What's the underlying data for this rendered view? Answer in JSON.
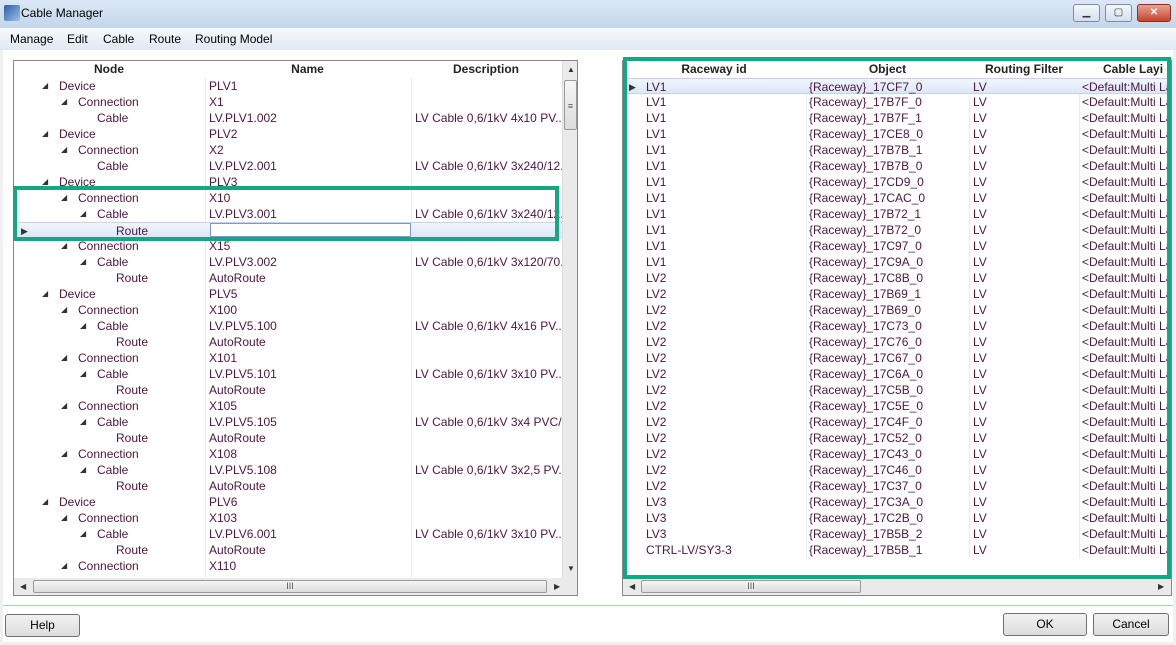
{
  "window": {
    "title": "Cable Manager",
    "minimize": "▁",
    "maximize": "▢",
    "close": "✕"
  },
  "menu": [
    "Manage",
    "Edit",
    "Cable",
    "Route",
    "Routing Model"
  ],
  "tree": {
    "columns": [
      "Node",
      "Name",
      "Description"
    ],
    "rows": [
      {
        "node": "Device",
        "level": 0,
        "expander": true,
        "name": "PLV1",
        "desc": ""
      },
      {
        "node": "Connection",
        "level": 1,
        "expander": true,
        "name": "X1",
        "desc": ""
      },
      {
        "node": "Cable",
        "level": 2,
        "expander": false,
        "name": "LV.PLV1.002",
        "desc": "LV Cable 0,6/1kV 4x10 PV..."
      },
      {
        "node": "Device",
        "level": 0,
        "expander": true,
        "name": "PLV2",
        "desc": ""
      },
      {
        "node": "Connection",
        "level": 1,
        "expander": true,
        "name": "X2",
        "desc": ""
      },
      {
        "node": "Cable",
        "level": 2,
        "expander": false,
        "name": "LV.PLV2.001",
        "desc": "LV Cable 0,6/1kV 3x240/12..."
      },
      {
        "node": "Device",
        "level": 0,
        "expander": true,
        "name": "PLV3",
        "desc": ""
      },
      {
        "node": "Connection",
        "level": 1,
        "expander": true,
        "name": "X10",
        "desc": ""
      },
      {
        "node": "Cable",
        "level": 2,
        "expander": true,
        "name": "LV.PLV3.001",
        "desc": "LV Cable 0,6/1kV 3x240/12..."
      },
      {
        "node": "Route",
        "level": 3,
        "expander": false,
        "name": "",
        "desc": "",
        "selected": true
      },
      {
        "node": "Connection",
        "level": 1,
        "expander": true,
        "name": "X15",
        "desc": ""
      },
      {
        "node": "Cable",
        "level": 2,
        "expander": true,
        "name": "LV.PLV3.002",
        "desc": "LV Cable 0,6/1kV 3x120/70..."
      },
      {
        "node": "Route",
        "level": 3,
        "expander": false,
        "name": "AutoRoute",
        "desc": ""
      },
      {
        "node": "Device",
        "level": 0,
        "expander": true,
        "name": "PLV5",
        "desc": ""
      },
      {
        "node": "Connection",
        "level": 1,
        "expander": true,
        "name": "X100",
        "desc": ""
      },
      {
        "node": "Cable",
        "level": 2,
        "expander": true,
        "name": "LV.PLV5.100",
        "desc": "LV Cable 0,6/1kV 4x16 PV..."
      },
      {
        "node": "Route",
        "level": 3,
        "expander": false,
        "name": "AutoRoute",
        "desc": ""
      },
      {
        "node": "Connection",
        "level": 1,
        "expander": true,
        "name": "X101",
        "desc": ""
      },
      {
        "node": "Cable",
        "level": 2,
        "expander": true,
        "name": "LV.PLV5.101",
        "desc": "LV Cable 0,6/1kV 3x10 PV..."
      },
      {
        "node": "Route",
        "level": 3,
        "expander": false,
        "name": "AutoRoute",
        "desc": ""
      },
      {
        "node": "Connection",
        "level": 1,
        "expander": true,
        "name": "X105",
        "desc": ""
      },
      {
        "node": "Cable",
        "level": 2,
        "expander": true,
        "name": "LV.PLV5.105",
        "desc": "LV Cable 0,6/1kV 3x4 PVC/..."
      },
      {
        "node": "Route",
        "level": 3,
        "expander": false,
        "name": "AutoRoute",
        "desc": ""
      },
      {
        "node": "Connection",
        "level": 1,
        "expander": true,
        "name": "X108",
        "desc": ""
      },
      {
        "node": "Cable",
        "level": 2,
        "expander": true,
        "name": "LV.PLV5.108",
        "desc": "LV Cable 0,6/1kV 3x2,5 PV..."
      },
      {
        "node": "Route",
        "level": 3,
        "expander": false,
        "name": "AutoRoute",
        "desc": ""
      },
      {
        "node": "Device",
        "level": 0,
        "expander": true,
        "name": "PLV6",
        "desc": ""
      },
      {
        "node": "Connection",
        "level": 1,
        "expander": true,
        "name": "X103",
        "desc": ""
      },
      {
        "node": "Cable",
        "level": 2,
        "expander": true,
        "name": "LV.PLV6.001",
        "desc": "LV Cable 0,6/1kV 3x10 PV..."
      },
      {
        "node": "Route",
        "level": 3,
        "expander": false,
        "name": "AutoRoute",
        "desc": ""
      },
      {
        "node": "Connection",
        "level": 1,
        "expander": true,
        "name": "X110",
        "desc": ""
      }
    ]
  },
  "raceways": {
    "columns": [
      "Raceway id",
      "Object",
      "Routing Filter",
      "Cable Layi"
    ],
    "rows": [
      [
        "LV1",
        "{Raceway}_17CF7_0",
        "LV",
        "<Default:Multi La"
      ],
      [
        "LV1",
        "{Raceway}_17B7F_0",
        "LV",
        "<Default:Multi La"
      ],
      [
        "LV1",
        "{Raceway}_17B7F_1",
        "LV",
        "<Default:Multi La"
      ],
      [
        "LV1",
        "{Raceway}_17CE8_0",
        "LV",
        "<Default:Multi La"
      ],
      [
        "LV1",
        "{Raceway}_17B7B_1",
        "LV",
        "<Default:Multi La"
      ],
      [
        "LV1",
        "{Raceway}_17B7B_0",
        "LV",
        "<Default:Multi La"
      ],
      [
        "LV1",
        "{Raceway}_17CD9_0",
        "LV",
        "<Default:Multi La"
      ],
      [
        "LV1",
        "{Raceway}_17CAC_0",
        "LV",
        "<Default:Multi La"
      ],
      [
        "LV1",
        "{Raceway}_17B72_1",
        "LV",
        "<Default:Multi La"
      ],
      [
        "LV1",
        "{Raceway}_17B72_0",
        "LV",
        "<Default:Multi La"
      ],
      [
        "LV1",
        "{Raceway}_17C97_0",
        "LV",
        "<Default:Multi La"
      ],
      [
        "LV1",
        "{Raceway}_17C9A_0",
        "LV",
        "<Default:Multi La"
      ],
      [
        "LV2",
        "{Raceway}_17C8B_0",
        "LV",
        "<Default:Multi La"
      ],
      [
        "LV2",
        "{Raceway}_17B69_1",
        "LV",
        "<Default:Multi La"
      ],
      [
        "LV2",
        "{Raceway}_17B69_0",
        "LV",
        "<Default:Multi La"
      ],
      [
        "LV2",
        "{Raceway}_17C73_0",
        "LV",
        "<Default:Multi La"
      ],
      [
        "LV2",
        "{Raceway}_17C76_0",
        "LV",
        "<Default:Multi La"
      ],
      [
        "LV2",
        "{Raceway}_17C67_0",
        "LV",
        "<Default:Multi La"
      ],
      [
        "LV2",
        "{Raceway}_17C6A_0",
        "LV",
        "<Default:Multi La"
      ],
      [
        "LV2",
        "{Raceway}_17C5B_0",
        "LV",
        "<Default:Multi La"
      ],
      [
        "LV2",
        "{Raceway}_17C5E_0",
        "LV",
        "<Default:Multi La"
      ],
      [
        "LV2",
        "{Raceway}_17C4F_0",
        "LV",
        "<Default:Multi La"
      ],
      [
        "LV2",
        "{Raceway}_17C52_0",
        "LV",
        "<Default:Multi La"
      ],
      [
        "LV2",
        "{Raceway}_17C43_0",
        "LV",
        "<Default:Multi La"
      ],
      [
        "LV2",
        "{Raceway}_17C46_0",
        "LV",
        "<Default:Multi La"
      ],
      [
        "LV2",
        "{Raceway}_17C37_0",
        "LV",
        "<Default:Multi La"
      ],
      [
        "LV3",
        "{Raceway}_17C3A_0",
        "LV",
        "<Default:Multi La"
      ],
      [
        "LV3",
        "{Raceway}_17C2B_0",
        "LV",
        "<Default:Multi La"
      ],
      [
        "LV3",
        "{Raceway}_17B5B_2",
        "LV",
        "<Default:Multi La"
      ],
      [
        "CTRL-LV/SY3-3",
        "{Raceway}_17B5B_1",
        "LV",
        "<Default:Multi La"
      ]
    ],
    "selected_row": 0
  },
  "scroll_grip": "III",
  "buttons": {
    "help": "Help",
    "ok": "OK",
    "cancel": "Cancel"
  },
  "colors": {
    "highlight": "#13a884",
    "text": "#4b1640"
  }
}
